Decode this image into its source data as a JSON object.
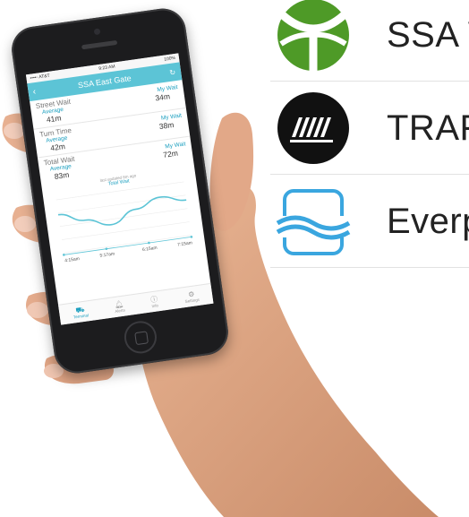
{
  "apps": [
    {
      "name": "SSA W",
      "icon": "ssa-wait-times-icon",
      "color": "#4e9a27"
    },
    {
      "name": "TRAF",
      "icon": "traffic-stripes-icon",
      "color": "#111111"
    },
    {
      "name": "Everp",
      "icon": "everport-waves-icon",
      "color": "#3aa6df"
    }
  ],
  "phone": {
    "status": {
      "carrier": "••••◦ AT&T",
      "time": "9:23 AM",
      "battery": "100%"
    },
    "title": "SSA East Gate",
    "sections": [
      {
        "title": "Street Wait",
        "avg_label": "Average",
        "avg": "41m",
        "mywait_label": "My Wait",
        "mywait": "34m"
      },
      {
        "title": "Turn Time",
        "avg_label": "Average",
        "avg": "42m",
        "mywait_label": "My Wait",
        "mywait": "38m"
      },
      {
        "title": "Total Wait",
        "avg_label": "Average",
        "avg": "83m",
        "mywait_label": "My Wait",
        "mywait": "72m"
      }
    ],
    "updated": "last updated 8m ago",
    "chart_title": "Total Wait",
    "tabs": [
      {
        "label": "Terminal",
        "icon": "truck-icon"
      },
      {
        "label": "Alerts",
        "icon": "bell-icon"
      },
      {
        "label": "Info",
        "icon": "info-icon"
      },
      {
        "label": "Settings",
        "icon": "gear-icon"
      }
    ],
    "accent": "#5cc4d6"
  },
  "chart_data": {
    "type": "line",
    "title": "Total Wait",
    "x": [
      "4:15am",
      "5:17am",
      "6:15am",
      "7:15am"
    ],
    "series": [
      {
        "values": [
          72,
          55,
          40,
          62,
          78,
          66
        ]
      }
    ],
    "xlabel": "",
    "ylabel": "",
    "ylim": [
      0,
      100
    ],
    "grid": true,
    "legend": "none"
  }
}
